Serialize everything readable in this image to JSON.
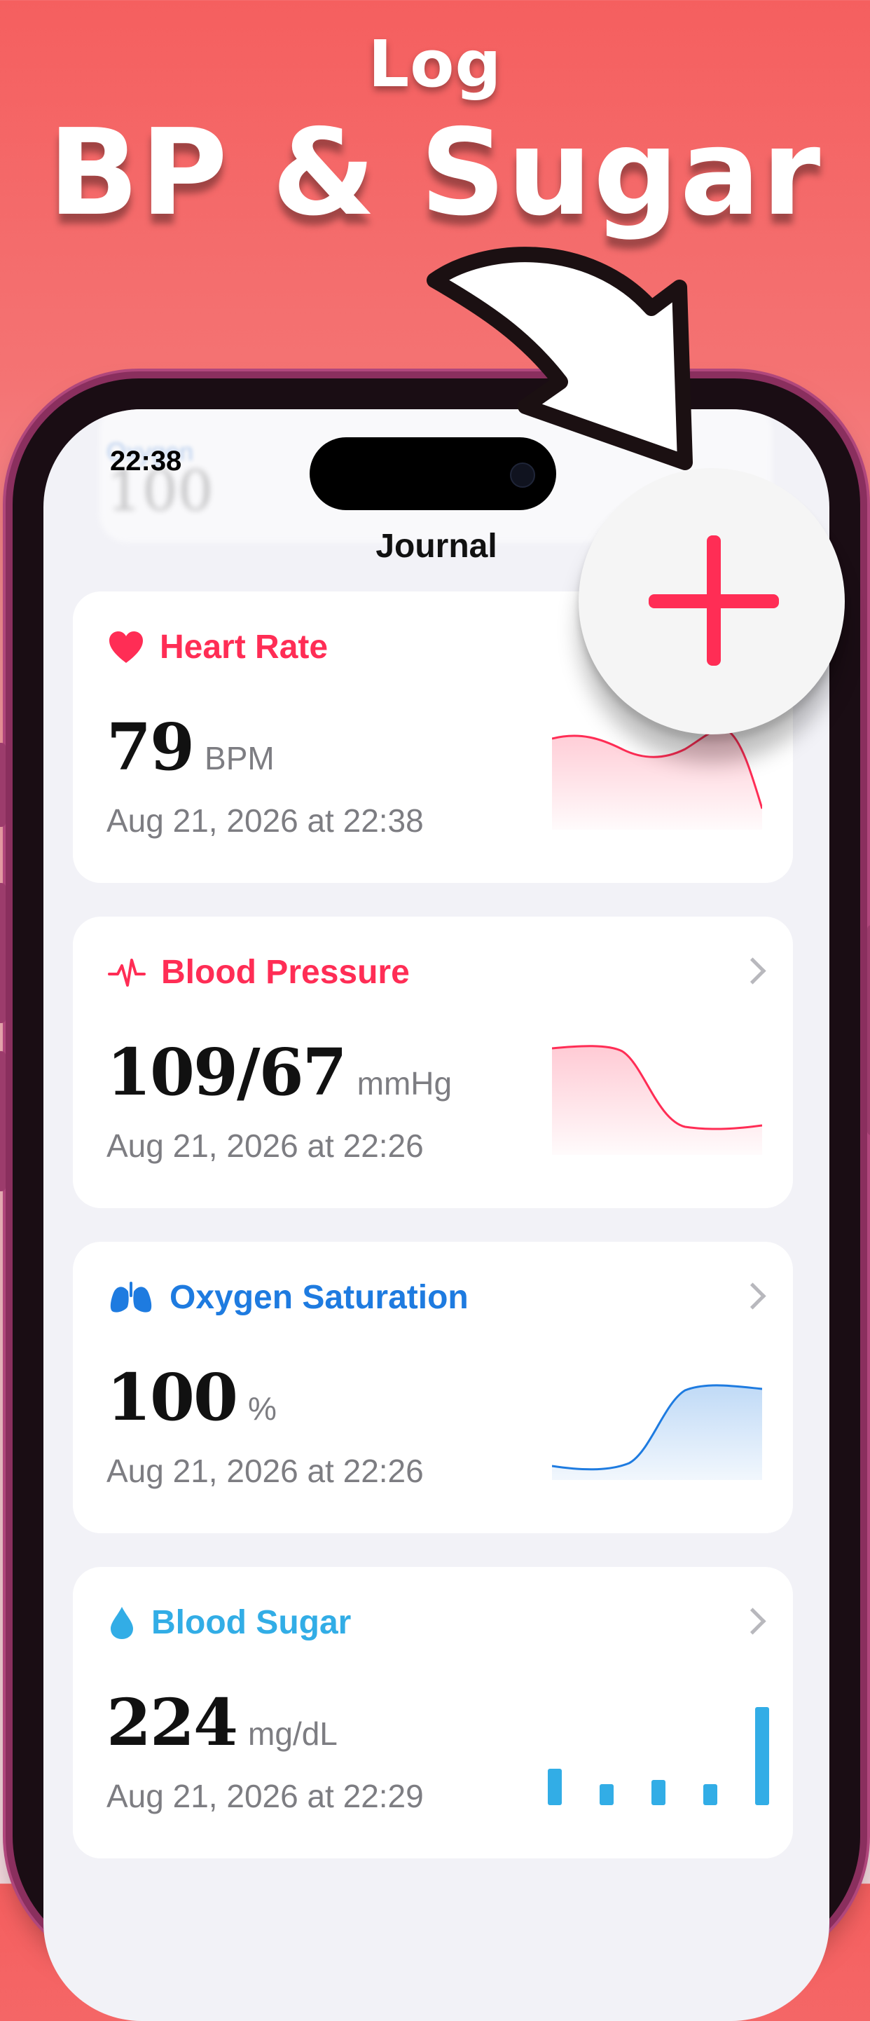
{
  "hero": {
    "line1": "Log",
    "line2": "BP & Sugar"
  },
  "status_bar": {
    "time": "22:38"
  },
  "nav": {
    "title": "Journal"
  },
  "background_ghost": {
    "label": "Oxygen",
    "value": "100"
  },
  "add_button": {
    "icon": "plus-icon",
    "color": "#ff2d55"
  },
  "cards": [
    {
      "title": "Heart Rate",
      "icon": "heart-icon",
      "color": "#ff2d55",
      "value": "79",
      "unit": "BPM",
      "timestamp": "Aug 21, 2026 at 22:38",
      "chart": "area-line"
    },
    {
      "title": "Blood Pressure",
      "icon": "waveform-icon",
      "color": "#ff2d55",
      "value": "109/67",
      "unit": "mmHg",
      "timestamp": "Aug 21, 2026 at 22:26",
      "chart": "area-line"
    },
    {
      "title": "Oxygen Saturation",
      "icon": "lungs-icon",
      "color": "#1e7be0",
      "value": "100",
      "unit": "%",
      "timestamp": "Aug 21, 2026 at 22:26",
      "chart": "area-line"
    },
    {
      "title": "Blood Sugar",
      "icon": "drop-icon",
      "color": "#32ade6",
      "value": "224",
      "unit": "mg/dL",
      "timestamp": "Aug 21, 2026 at 22:29",
      "chart": "bars"
    }
  ]
}
